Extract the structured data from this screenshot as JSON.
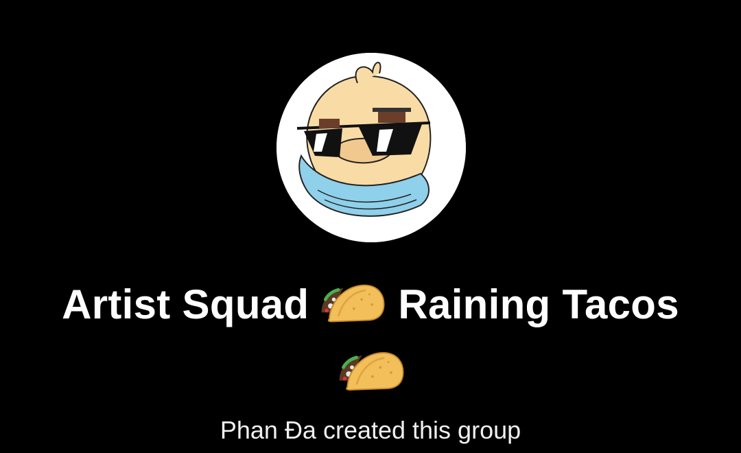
{
  "group": {
    "avatar_icon": "duck-with-sunglasses-and-scarf-avatar",
    "name_part1": "Artist Squad",
    "name_part2": "Raining Tacos",
    "emoji_icon": "taco-emoji",
    "created_text": "Phan Đa created this group"
  },
  "colors": {
    "background": "#000000",
    "text": "#ffffff",
    "avatar_ring": "#ffffff",
    "duck_skin": "#f9dba5",
    "scarf": "#8fd0ea",
    "taco_shell": "#f3bf5b"
  }
}
